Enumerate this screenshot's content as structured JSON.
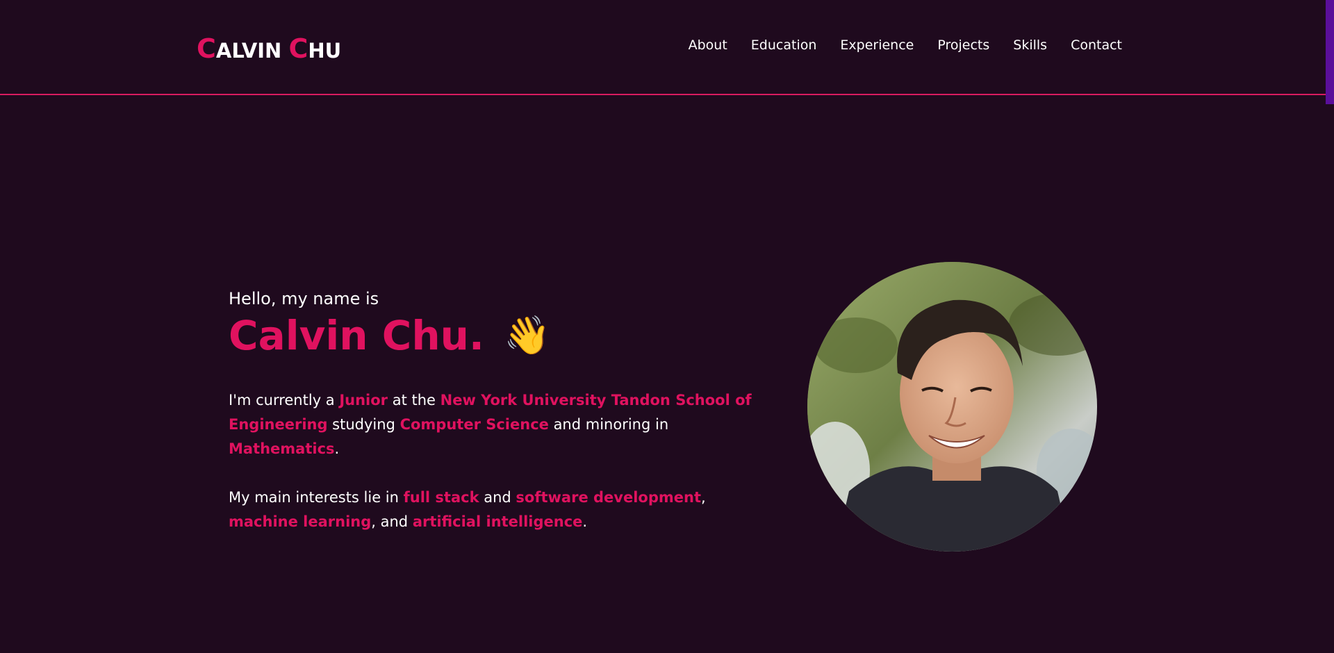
{
  "header": {
    "logo": {
      "first_initial": "C",
      "first_rest": "ALVIN",
      "last_initial": "C",
      "last_rest": "HU"
    },
    "nav": [
      {
        "label": "About"
      },
      {
        "label": "Education"
      },
      {
        "label": "Experience"
      },
      {
        "label": "Projects"
      },
      {
        "label": "Skills"
      },
      {
        "label": "Contact"
      }
    ]
  },
  "hero": {
    "greeting": "Hello, my name is",
    "name": "Calvin Chu.",
    "wave_emoji": "👋",
    "para1": {
      "t1": "I'm currently a ",
      "h1": "Junior",
      "t2": " at the ",
      "h2": "New York University Tandon School of Engineering",
      "t3": " studying ",
      "h3": "Computer Science",
      "t4": " and minoring in ",
      "h4": "Mathematics",
      "t5": "."
    },
    "para2": {
      "t1": "My main interests lie in ",
      "h1": "full stack",
      "t2": " and ",
      "h2": "software development",
      "t3": ", ",
      "h3": "machine learning",
      "t4": ", and ",
      "h4": "artificial intelligence",
      "t5": "."
    }
  },
  "colors": {
    "background": "#1f0a1e",
    "accent": "#e0125f",
    "divider": "#d81b60",
    "scroll_indicator": "#5a0f9a"
  }
}
